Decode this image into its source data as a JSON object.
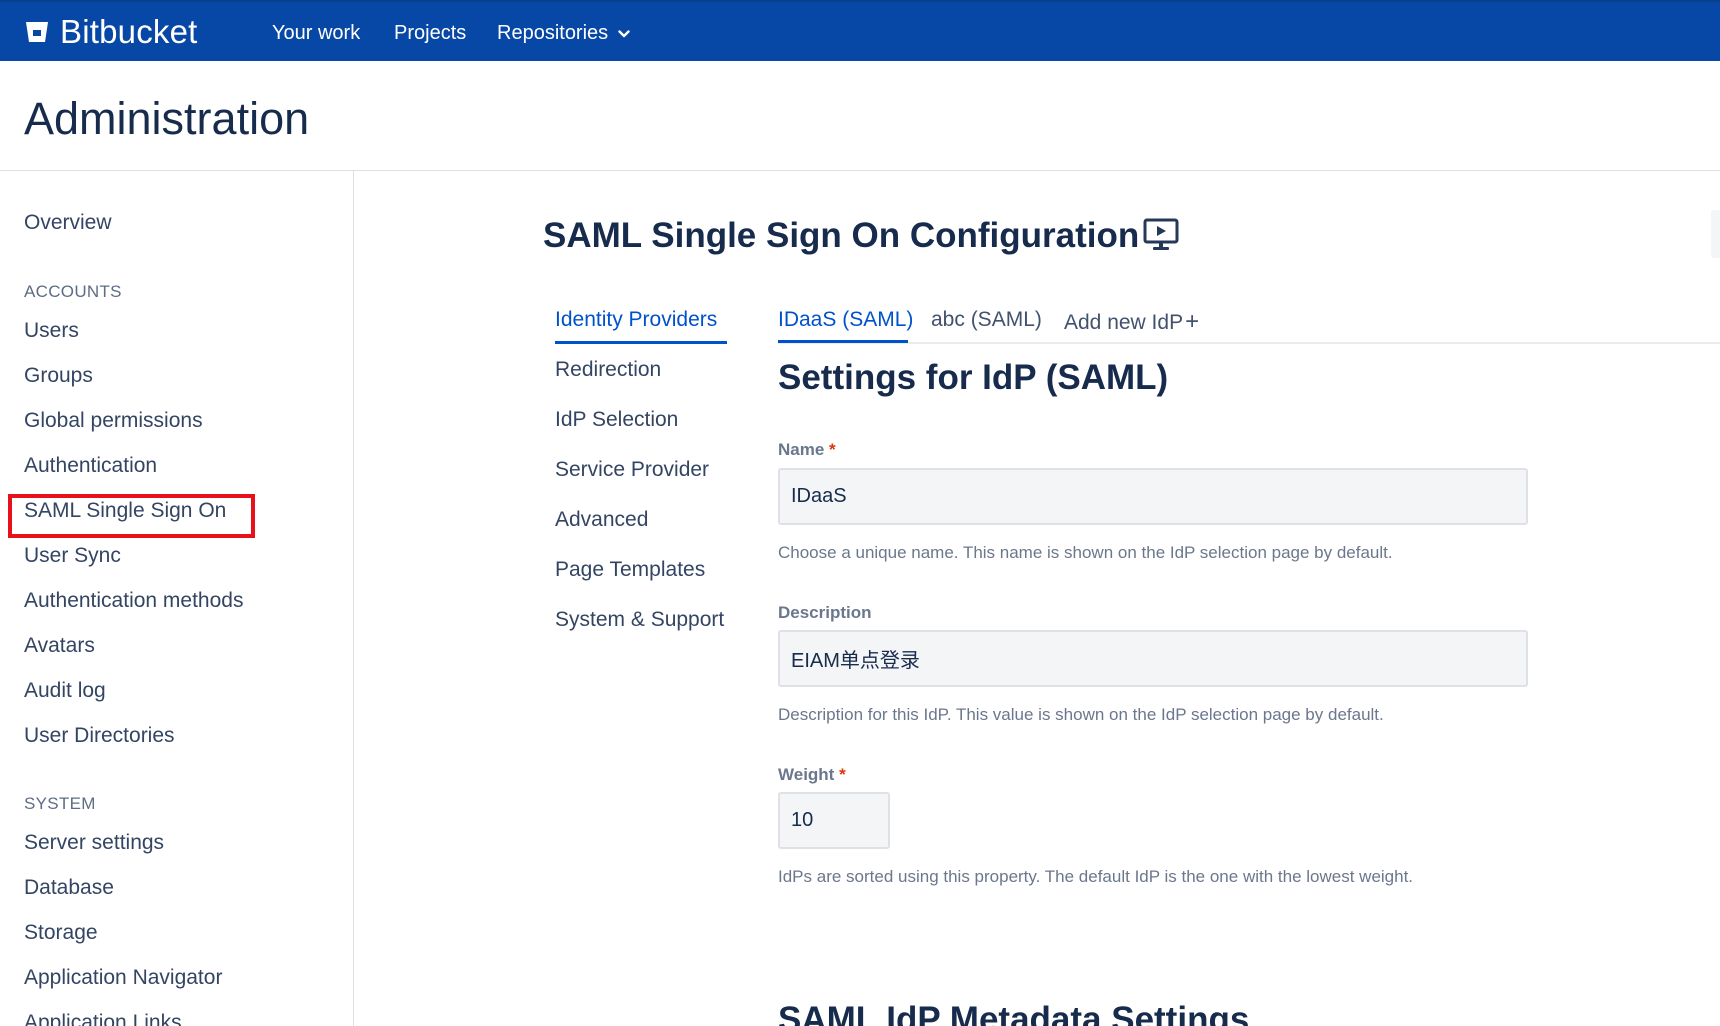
{
  "app": {
    "name": "Bitbucket"
  },
  "nav": {
    "your_work": "Your work",
    "projects": "Projects",
    "repositories": "Repositories"
  },
  "page": {
    "title": "Administration"
  },
  "sidebar": {
    "overview": "Overview",
    "accounts_heading": "ACCOUNTS",
    "accounts": [
      "Users",
      "Groups",
      "Global permissions",
      "Authentication",
      "SAML Single Sign On",
      "User Sync",
      "Authentication methods",
      "Avatars",
      "Audit log",
      "User Directories"
    ],
    "system_heading": "SYSTEM",
    "system": [
      "Server settings",
      "Database",
      "Storage",
      "Application Navigator",
      "Application Links"
    ],
    "selected": "SAML Single Sign On"
  },
  "main": {
    "title": "SAML Single Sign On Configuration",
    "subnav": [
      "Identity Providers",
      "Redirection",
      "IdP Selection",
      "Service Provider",
      "Advanced",
      "Page Templates",
      "System & Support"
    ],
    "tabs": [
      "IDaaS (SAML)",
      "abc (SAML)",
      "Add new IdP"
    ],
    "add_glyph": "+",
    "section_title": "Settings for IdP (SAML)",
    "required_mark": "*",
    "fields": {
      "name": {
        "label": "Name",
        "value": "IDaaS",
        "help": "Choose a unique name. This name is shown on the IdP selection page by default."
      },
      "description": {
        "label": "Description",
        "value": "EIAM单点登录",
        "help": "Description for this IdP. This value is shown on the IdP selection page by default."
      },
      "weight": {
        "label": "Weight",
        "value": "10",
        "help": "IdPs are sorted using this property. The default IdP is the one with the lowest weight."
      }
    },
    "next_section_title": "SAML IdP Metadata Settings"
  },
  "colors": {
    "topbar": "#0747a6",
    "accent": "#0052cc",
    "highlight": "#e8101a"
  }
}
